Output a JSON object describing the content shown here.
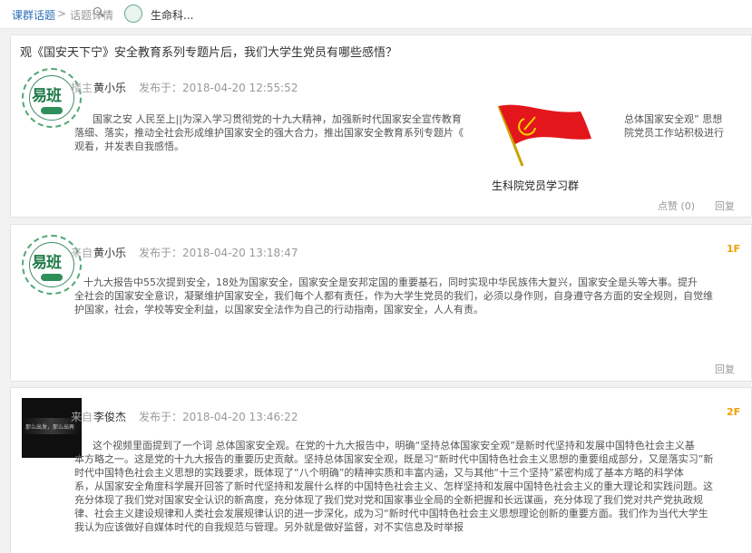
{
  "breadcrumb": {
    "root": "课群话题",
    "sep": ">",
    "topic_detail": "话题详情",
    "group": "生命科..."
  },
  "main_post": {
    "title": "观《国安天下宁》安全教育系列专题片后，我们大学生党员有哪些感悟？",
    "floor_label": "楼主",
    "author": "黄小乐",
    "posted_at": "发布于：2018-04-20 12:55:52",
    "body": [
      "国家之安 人民至上||为深入学习贯彻党的十九大精神，加强新时代国家安全宣传教育",
      "落细、落实，推动全社会形成维护国家安全的强大合力，推出国家安全教育系列专题片《",
      "观看，并发表自我感悟。"
    ],
    "body_right": [
      "总体国家安全观” 思想",
      "院党员工作站积极进行"
    ],
    "image_caption": "生科院党员学习群",
    "like_label": "点赞 (0)",
    "reply_label": "回复"
  },
  "replies": [
    {
      "floor_label": "来自",
      "author": "黄小乐",
      "posted_at": "发布于：2018-04-20 13:18:47",
      "floor": "1F",
      "body": [
        "十九大报告中55次提到安全，18处为国家安全，国家安全是安邦定国的重要基石，同时实现中华民族伟大复兴，国家安全是头等大事。提升",
        "全社会的国家安全意识，凝聚维护国家安全，我们每个人都有责任，作为大学生党员的我们，必须以身作则，自身遵守各方面的安全规则，自觉维",
        "护国家，社会，学校等安全利益，以国家安全法作为自己的行动指南，国家安全，人人有责。"
      ],
      "reply_label": "回复"
    },
    {
      "floor_label": "来自",
      "author": "李俊杰",
      "posted_at": "发布于：2018-04-20 13:46:22",
      "floor": "2F",
      "avatar_caption": "那么出发，那么出再",
      "body": [
        "这个视频里面提到了一个词 总体国家安全观。在党的十九大报告中，明确“坚持总体国家安全观”是新时代坚持和发展中国特色社会主义基",
        "本方略之一。这是党的十九大报告的重要历史贡献。坚持总体国家安全观，既是习“新时代中国特色社会主义思想的重要组成部分，又是落实习”新",
        "时代中国特色社会主义思想的实践要求，既体现了“八个明确”的精神实质和丰富内涵，又与其他“十三个坚持”紧密构成了基本方略的科学体",
        "系，从国家安全角度科学展开回答了新时代坚持和发展什么样的中国特色社会主义、怎样坚持和发展中国特色社会主义的重大理论和实践问题。这",
        "充分体现了我们党对国家安全认识的新高度，充分体现了我们党对党和国家事业全局的全新把握和长远谋画，充分体现了我们党对共产党执政规",
        "律、社会主义建设规律和人类社会发展规律认识的进一步深化，成为习“新时代中国特色社会主义思想理论创新的重要方面。我们作为当代大学生",
        "我认为应该做好自媒体时代的自我规范与管理。另外就是做好监督，对不实信息及时举报"
      ]
    }
  ],
  "avatar_logo_text": "易班"
}
